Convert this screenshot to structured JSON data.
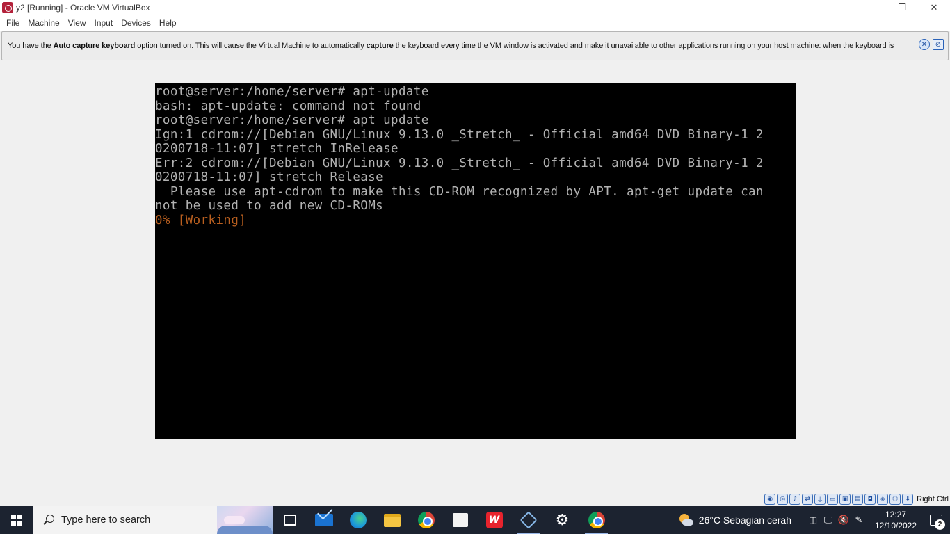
{
  "window": {
    "title": "y2 [Running] - Oracle VM VirtualBox",
    "controls": {
      "minimize": "—",
      "restore": "❐",
      "close": "✕"
    }
  },
  "menu": [
    "File",
    "Machine",
    "View",
    "Input",
    "Devices",
    "Help"
  ],
  "notification": {
    "part1": "You have the ",
    "bold1": "Auto capture keyboard",
    "part2": " option turned on. This will cause the Virtual Machine to automatically ",
    "bold2": "capture",
    "part3": " the keyboard every time the VM window is activated and make it unavailable to other applications running on your host machine: when the keyboard is"
  },
  "terminal": {
    "lines": [
      "root@server:/home/server# apt-update",
      "bash: apt-update: command not found",
      "root@server:/home/server# apt update",
      "Ign:1 cdrom://[Debian GNU/Linux 9.13.0 _Stretch_ - Official amd64 DVD Binary-1 2",
      "0200718-11:07] stretch InRelease",
      "Err:2 cdrom://[Debian GNU/Linux 9.13.0 _Stretch_ - Official amd64 DVD Binary-1 2",
      "0200718-11:07] stretch Release",
      "  Please use apt-cdrom to make this CD-ROM recognized by APT. apt-get update can",
      "not be used to add new CD-ROMs"
    ],
    "progress_line": "0% [Working]",
    "text_color": "#b2b2b2",
    "progress_color": "#b95f1f"
  },
  "vm_status": {
    "host_key": "Right Ctrl"
  },
  "taskbar": {
    "search_placeholder": "Type here to search",
    "weather": "26°C  Sebagian cerah",
    "time": "12:27",
    "date": "12/10/2022",
    "notification_count": "2"
  }
}
